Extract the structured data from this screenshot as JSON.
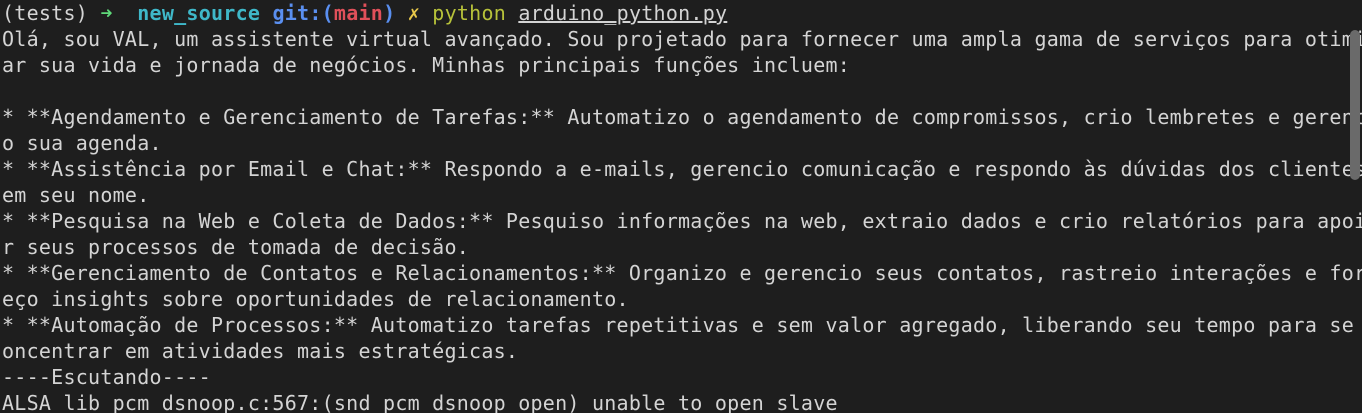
{
  "prompt": {
    "venv": "(tests)",
    "arrow": "➜",
    "directory": "new_source",
    "git_label": "git:",
    "git_open": "(",
    "branch": "main",
    "git_close": ")",
    "dirty_mark": "✗",
    "command": "python",
    "argument": "arduino_python.py"
  },
  "output_lines": [
    "Olá, sou VAL, um assistente virtual avançado. Sou projetado para fornecer uma ampla gama de serviços para otimiz",
    "ar sua vida e jornada de negócios. Minhas principais funções incluem:",
    "",
    "* **Agendamento e Gerenciamento de Tarefas:** Automatizo o agendamento de compromissos, crio lembretes e gerenci",
    "o sua agenda.",
    "* **Assistência por Email e Chat:** Respondo a e-mails, gerencio comunicação e respondo às dúvidas dos clientes",
    "em seu nome.",
    "* **Pesquisa na Web e Coleta de Dados:** Pesquiso informações na web, extraio dados e crio relatórios para apoia",
    "r seus processos de tomada de decisão.",
    "* **Gerenciamento de Contatos e Relacionamentos:** Organizo e gerencio seus contatos, rastreio interações e forn",
    "eço insights sobre oportunidades de relacionamento.",
    "* **Automação de Processos:** Automatizo tarefas repetitivas e sem valor agregado, liberando seu tempo para se c",
    "oncentrar em atividades mais estratégicas.",
    "----Escutando----",
    "ALSA lib pcm_dsnoop.c:567:(snd_pcm_dsnoop_open) unable to open slave"
  ]
}
